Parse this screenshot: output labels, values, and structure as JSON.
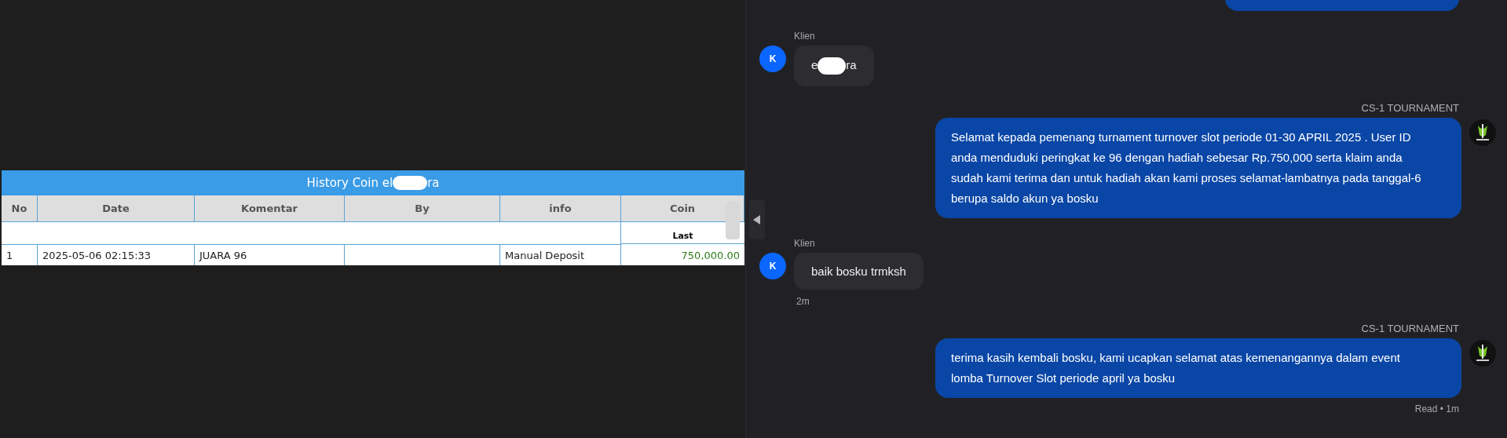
{
  "history_table": {
    "title_prefix": "History Coin el",
    "title_suffix": "ra",
    "columns": [
      "No",
      "Date",
      "Komentar",
      "By",
      "info",
      "Coin"
    ],
    "subheader": "Last",
    "rows": [
      {
        "no": "1",
        "date": "2025-05-06 02:15:33",
        "komentar": "JUARA 96",
        "info": "Manual Deposit",
        "coin": "750,000.00"
      }
    ]
  },
  "chat": {
    "messages": [
      {
        "kind": "partial"
      },
      {
        "kind": "client",
        "sender": "Klien",
        "avatar": "K",
        "text_prefix": "e",
        "text_suffix": "ra"
      },
      {
        "kind": "agent",
        "sender": "CS-1 TOURNAMENT",
        "text": "Selamat kepada pemenang turnament turnover slot periode 01-30 APRIL 2025 . User ID anda menduduki peringkat ke 96 dengan hadiah sebesar Rp.750,000 serta klaim anda sudah kami terima dan untuk hadiah akan kami proses selamat-lambatnya pada tanggal-6 berupa saldo akun ya bosku"
      },
      {
        "kind": "client",
        "sender": "Klien",
        "avatar": "K",
        "text_prefix": "baik bosku trmksh",
        "time": "2m"
      },
      {
        "kind": "agent",
        "sender": "CS-1 TOURNAMENT",
        "text": "terima kasih kembali bosku, kami ucapkan selamat atas kemenangannya dalam event lomba Turnover Slot periode april ya bosku",
        "status": "Read • 1m"
      }
    ]
  }
}
